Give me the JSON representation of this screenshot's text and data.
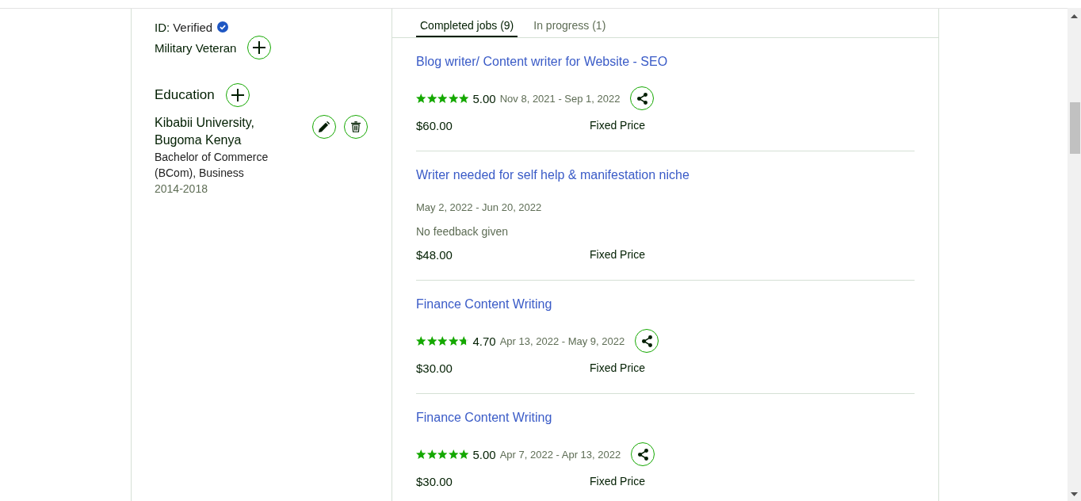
{
  "profile": {
    "id_label": "ID:",
    "id_status": "Verified",
    "verified": true,
    "military_veteran": {
      "label": "Military Veteran"
    }
  },
  "education": {
    "heading": "Education",
    "entries": [
      {
        "school": "Kibabii University, Bugoma Kenya",
        "degree": "Bachelor of Commerce (BCom), Business",
        "years": "2014-2018"
      }
    ]
  },
  "work_history": {
    "tabs": [
      {
        "label": "Completed jobs (9)",
        "selected": true
      },
      {
        "label": "In progress (1)",
        "selected": false
      }
    ],
    "jobs": [
      {
        "kind": "rated",
        "title": "Blog writer/ Content writer for Website - SEO",
        "stars": 5,
        "rating": "5.00",
        "dates": "Nov 8, 2021 - Sep 1, 2022",
        "price": "$60.00",
        "contract_type": "Fixed Price"
      },
      {
        "kind": "no_feedback",
        "title": "Writer needed for self help & manifestation niche",
        "dates": "May 2, 2022 - Jun 20, 2022",
        "feedback": "No feedback given",
        "price": "$48.00",
        "contract_type": "Fixed Price"
      },
      {
        "kind": "rated",
        "title": "Finance Content Writing",
        "stars": 4.7,
        "rating": "4.70",
        "dates": "Apr 13, 2022 - May 9, 2022",
        "price": "$30.00",
        "contract_type": "Fixed Price"
      },
      {
        "kind": "rated",
        "title": "Finance Content Writing",
        "stars": 5,
        "rating": "5.00",
        "dates": "Apr 7, 2022 - Apr 13, 2022",
        "price": "$30.00",
        "contract_type": "Fixed Price"
      }
    ]
  }
}
